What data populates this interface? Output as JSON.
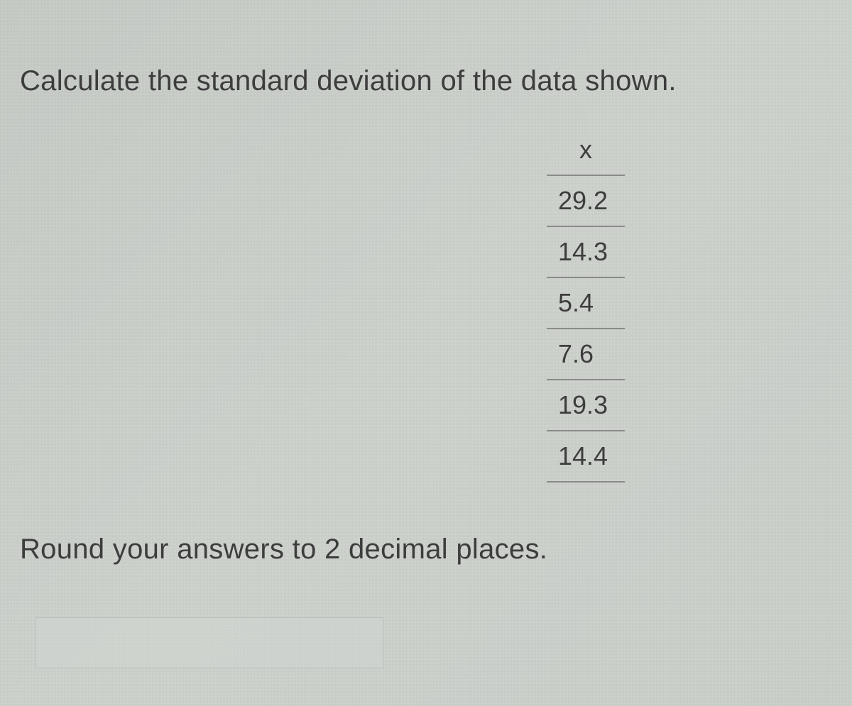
{
  "question": "Calculate the standard deviation of the data shown.",
  "table": {
    "header": "x",
    "values": [
      "29.2",
      "14.3",
      "5.4",
      "7.6",
      "19.3",
      "14.4"
    ]
  },
  "instruction": "Round your answers to 2 decimal places.",
  "answer_value": ""
}
